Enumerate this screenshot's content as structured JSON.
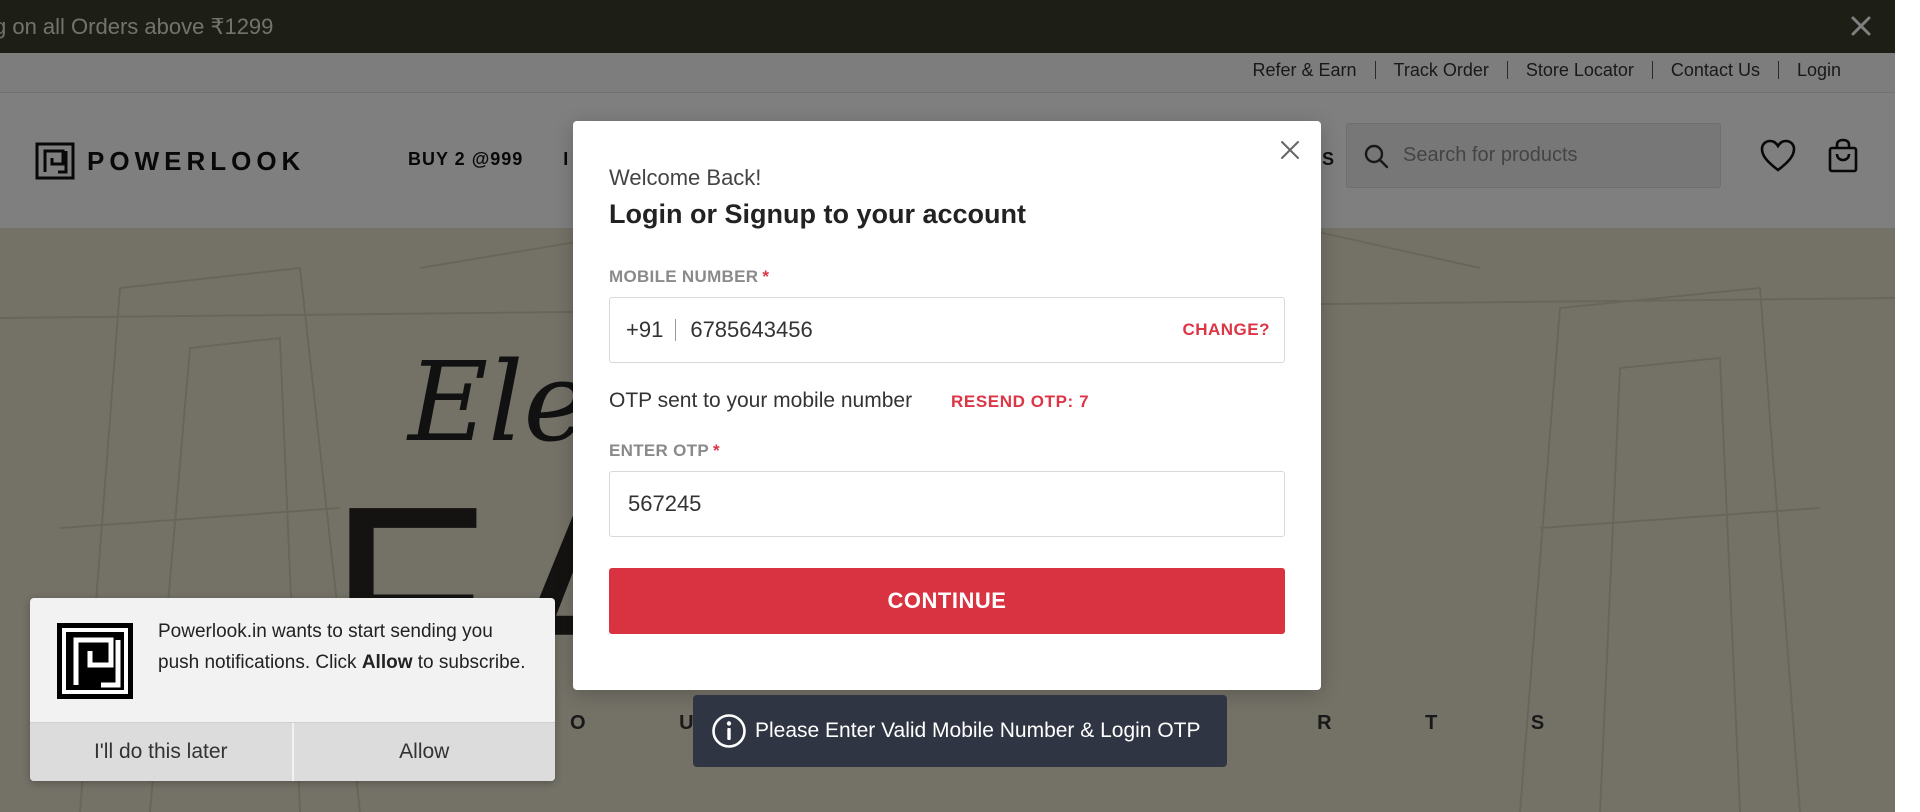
{
  "announcement": {
    "text": "g on all Orders above ₹1299"
  },
  "utility_links": [
    "Refer & Earn",
    "Track Order",
    "Store Locator",
    "Contact Us",
    "Login"
  ],
  "header": {
    "logo_text": "POWERLOOK",
    "nav": [
      "BUY 2 @999",
      "I",
      "S"
    ],
    "search_placeholder": "Search for products"
  },
  "hero": {
    "script_text": "Ele",
    "big_text": "FA    ON",
    "sub_text": "O U R                D  S H I R T S"
  },
  "modal": {
    "welcome": "Welcome Back!",
    "title": "Login or Signup to your account",
    "mobile_label": "MOBILE NUMBER",
    "required_mark": "*",
    "country_code": "+91",
    "mobile_value": "6785643456",
    "change_label": "CHANGE?",
    "otp_sent_text": "OTP sent to your mobile number",
    "resend_label": "RESEND OTP: 7",
    "otp_label": "ENTER OTP",
    "otp_value": "567245",
    "continue_label": "CONTINUE"
  },
  "toast": {
    "message": "Please Enter Valid Mobile Number & Login OTP"
  },
  "push_prompt": {
    "text_before": "Powerlook.in wants to start sending you push notifications. Click ",
    "bold_word": "Allow",
    "text_after": " to subscribe.",
    "later_label": "I'll do this later",
    "allow_label": "Allow"
  },
  "colors": {
    "accent_red": "#d93240",
    "announce_bg": "#3b3c2a",
    "toast_bg": "#2f3542",
    "hero_bg": "#e9e5cf"
  },
  "icons": [
    "close-icon",
    "search-icon",
    "heart-icon",
    "bag-icon",
    "info-icon",
    "powerlook-logo-icon"
  ]
}
